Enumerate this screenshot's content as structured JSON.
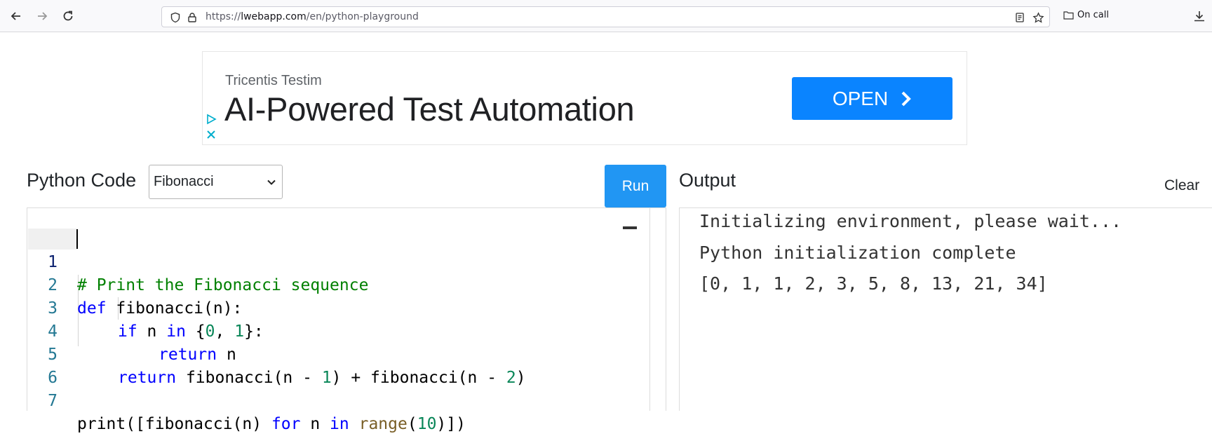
{
  "browser": {
    "url_prefix": "https://",
    "url_host": "lwebapp.com",
    "url_path": "/en/python-playground",
    "bookmark_folder": "On call"
  },
  "ad": {
    "brand": "Tricentis Testim",
    "headline": "AI-Powered Test Automation",
    "cta": "OPEN"
  },
  "code_panel": {
    "title": "Python Code",
    "example_selected": "Fibonacci",
    "run_label": "Run",
    "lines": [
      {
        "n": "1"
      },
      {
        "n": "2"
      },
      {
        "n": "3"
      },
      {
        "n": "4"
      },
      {
        "n": "5"
      },
      {
        "n": "6"
      },
      {
        "n": "7"
      }
    ],
    "tokens": {
      "l1_comment": "# Print the Fibonacci sequence",
      "l2_def": "def",
      "l2_rest": " fibonacci(n):",
      "l3_if": "if",
      "l3_a": " n ",
      "l3_in": "in",
      "l3_b": " {",
      "l3_0": "0",
      "l3_c": ", ",
      "l3_1": "1",
      "l3_d": "}:",
      "l4_return": "return",
      "l4_rest": " n",
      "l5_return": "return",
      "l5_a": " fibonacci(n - ",
      "l5_1": "1",
      "l5_b": ") + fibonacci(n - ",
      "l5_2": "2",
      "l5_c": ")",
      "l7_a": "print([fibonacci(n) ",
      "l7_for": "for",
      "l7_b": " n ",
      "l7_in": "in",
      "l7_c": " ",
      "l7_range": "range",
      "l7_d": "(",
      "l7_10": "10",
      "l7_e": ")])"
    }
  },
  "output_panel": {
    "title": "Output",
    "clear_label": "Clear",
    "lines": [
      "Initializing environment, please wait...",
      "Python initialization complete",
      "[0, 1, 1, 2, 3, 5, 8, 13, 21, 34]"
    ]
  },
  "colors": {
    "run_button": "#2196f3",
    "ad_button": "#0a84ff",
    "keyword": "#0000ff",
    "comment": "#008000",
    "number": "#098658",
    "line_number": "#237893"
  }
}
